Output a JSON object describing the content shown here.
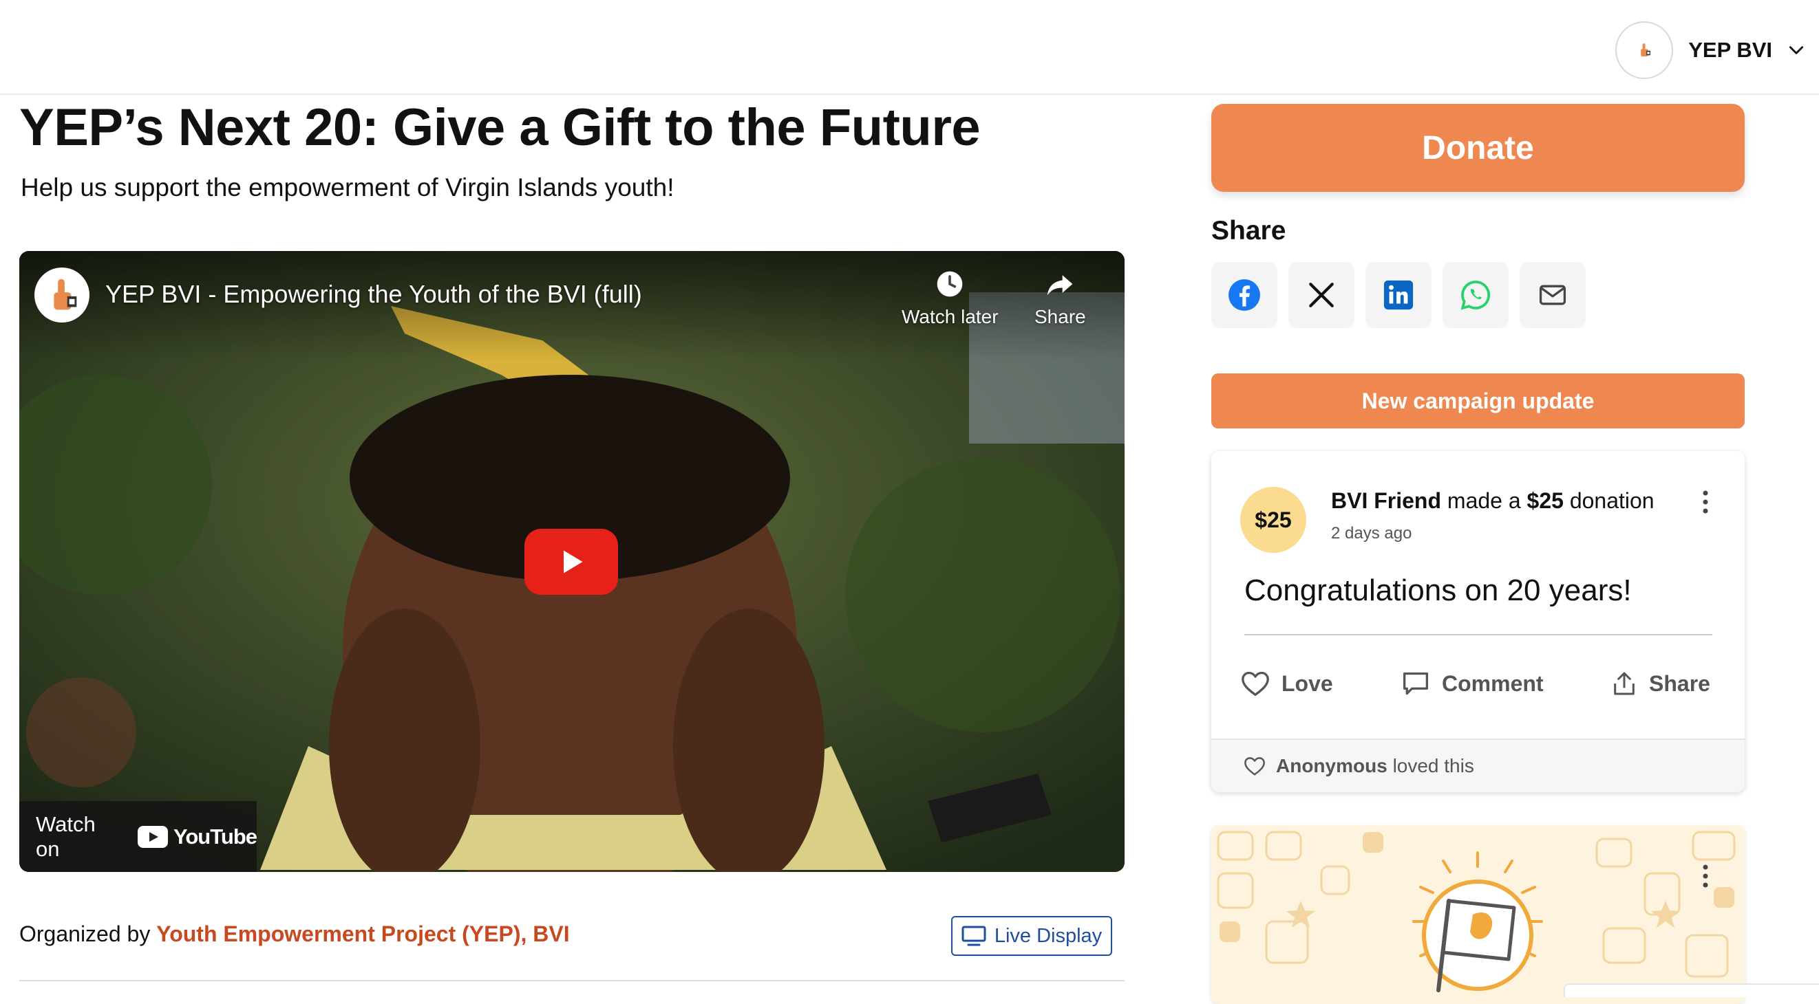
{
  "header": {
    "user_name": "YEP BVI"
  },
  "campaign": {
    "title": "YEP’s Next 20: Give a Gift to the Future",
    "subtitle": "Help us support the empowerment of Virgin Islands youth!"
  },
  "video": {
    "title": "YEP BVI - Empowering the Youth of the BVI (full)",
    "watch_later_label": "Watch later",
    "share_label": "Share",
    "watch_on_label": "Watch on",
    "youtube_label": "YouTube"
  },
  "organizer": {
    "prefix": "Organized by ",
    "name": "Youth Empowerment Project (YEP), BVI",
    "live_display_label": "Live Display"
  },
  "sidebar": {
    "donate_label": "Donate",
    "share_heading": "Share",
    "share_icons": [
      "facebook-icon",
      "x-icon",
      "linkedin-icon",
      "whatsapp-icon",
      "email-icon"
    ],
    "new_update_label": "New campaign update"
  },
  "donation": {
    "badge": "$25",
    "donor": "BVI Friend",
    "verb": " made a ",
    "amount": "$25",
    "suffix": " donation",
    "time": "2 days ago",
    "message": "Congratulations on 20 years!",
    "love_label": "Love",
    "comment_label": "Comment",
    "share_label": "Share",
    "footer_name": "Anonymous",
    "footer_text": "loved this"
  },
  "colors": {
    "accent": "#ef8750",
    "organizer_link": "#c8491f",
    "live_display": "#1f4e9e",
    "badge_bg": "#fbdb8f",
    "youtube_red": "#e62117"
  }
}
